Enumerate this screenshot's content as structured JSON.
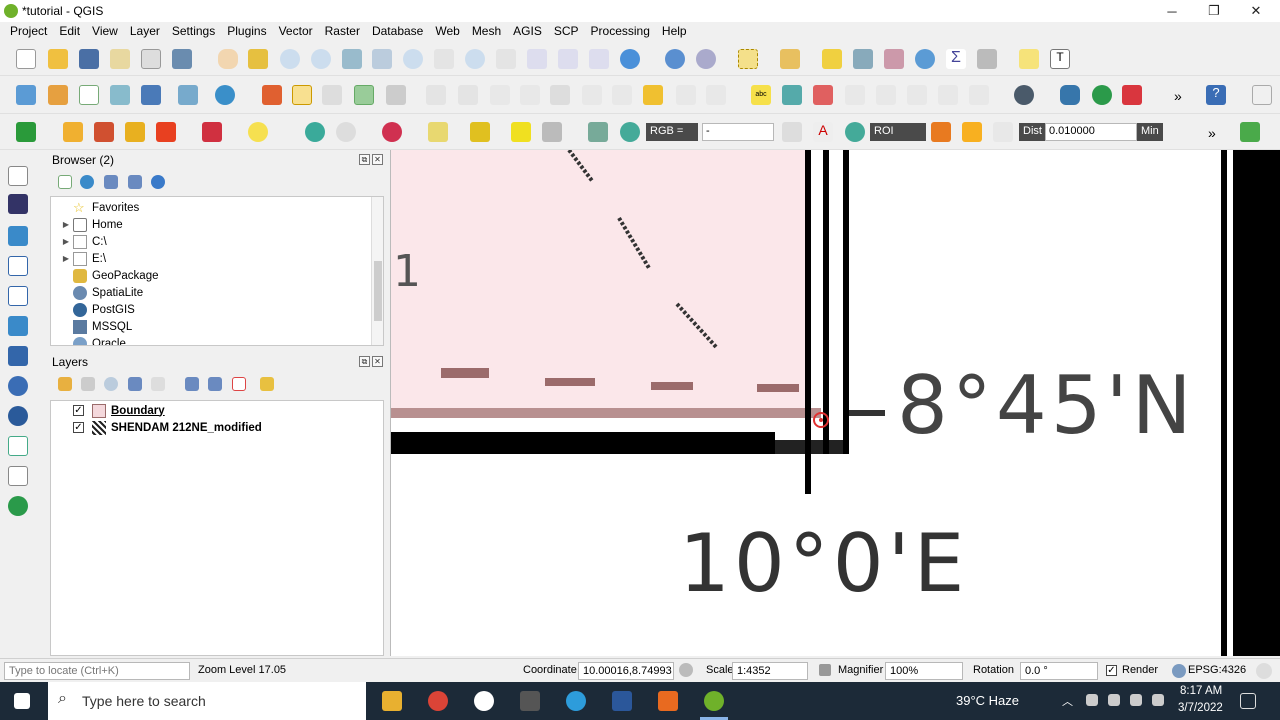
{
  "window": {
    "title": "*tutorial - QGIS",
    "minimize": "─",
    "restore": "❐",
    "close": "✕"
  },
  "menu": [
    "Project",
    "Edit",
    "View",
    "Layer",
    "Settings",
    "Plugins",
    "Vector",
    "Raster",
    "Database",
    "Web",
    "Mesh",
    "AGIS",
    "SCP",
    "Processing",
    "Help"
  ],
  "toolbar3": {
    "rgb_label": "RGB =",
    "rgb_value": "-",
    "roi_label": "ROI",
    "dist_label": "Dist",
    "dist_value": "0.010000",
    "min_label": "Min",
    "more": "»"
  },
  "toolbar2": {
    "more": "»"
  },
  "browser": {
    "title": "Browser (2)",
    "items": [
      {
        "label": "Favorites",
        "icon": "star-icon",
        "expandable": false
      },
      {
        "label": "Home",
        "icon": "home-folder-icon",
        "expandable": true
      },
      {
        "label": "C:\\",
        "icon": "drive-icon",
        "expandable": true
      },
      {
        "label": "E:\\",
        "icon": "drive-icon",
        "expandable": true
      },
      {
        "label": "GeoPackage",
        "icon": "geopackage-icon",
        "expandable": false
      },
      {
        "label": "SpatiaLite",
        "icon": "spatialite-icon",
        "expandable": false
      },
      {
        "label": "PostGIS",
        "icon": "postgis-icon",
        "expandable": false
      },
      {
        "label": "MSSQL",
        "icon": "mssql-icon",
        "expandable": false
      },
      {
        "label": "Oracle",
        "icon": "oracle-icon",
        "expandable": false
      }
    ]
  },
  "layers": {
    "title": "Layers",
    "items": [
      {
        "label": "Boundary",
        "checked": true,
        "bold": true,
        "icon": "polygon-layer-icon"
      },
      {
        "label": "SHENDAM 212NE_modified",
        "checked": true,
        "bold": false,
        "icon": "raster-layer-icon"
      }
    ]
  },
  "map": {
    "lat_label": "8°45'N",
    "lon_label": "10°0'E",
    "left_fragment": "1"
  },
  "status": {
    "locate_placeholder": "Type to locate (Ctrl+K)",
    "zoom_level": "Zoom Level 17.05",
    "coordinate_label": "Coordinate",
    "coordinate_value": "10.00016,8.74993",
    "scale_label": "Scale",
    "scale_value": "1:4352",
    "magnifier_label": "Magnifier",
    "magnifier_value": "100%",
    "rotation_label": "Rotation",
    "rotation_value": "0.0 °",
    "render_label": "Render",
    "render_checked": true,
    "crs": "EPSG:4326"
  },
  "taskbar": {
    "search_placeholder": "Type here to search",
    "weather": "39°C  Haze",
    "time": "8:17 AM",
    "date": "3/7/2022"
  },
  "colors": {
    "map_pink": "#fbe7ea",
    "boundary_line": "#9b6b6b",
    "taskbar": "#1c2a38"
  }
}
